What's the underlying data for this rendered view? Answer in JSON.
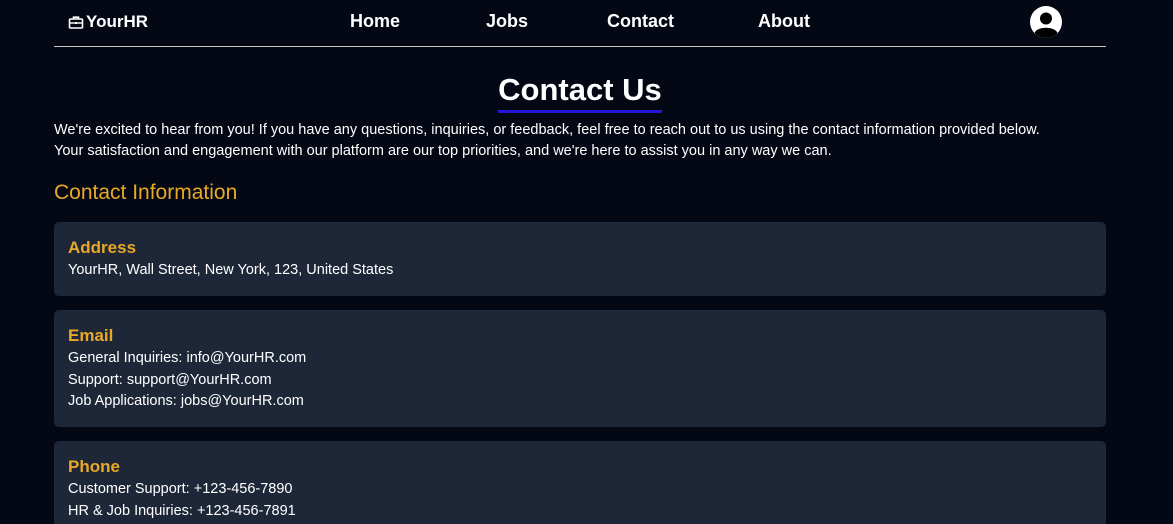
{
  "nav": {
    "brand": "YourHR",
    "links": [
      "Home",
      "Jobs",
      "Contact",
      "About"
    ]
  },
  "page": {
    "title": "Contact Us",
    "intro_line1": "We're excited to hear from you! If you have any questions, inquiries, or feedback, feel free to reach out to us using the contact information provided below.",
    "intro_line2": "Your satisfaction and engagement with our platform are our top priorities, and we're here to assist you in any way we can.",
    "section_title": "Contact Information"
  },
  "cards": {
    "address": {
      "title": "Address",
      "lines": [
        "YourHR, Wall Street, New York, 123, United States"
      ]
    },
    "email": {
      "title": "Email",
      "lines": [
        "General Inquiries: info@YourHR.com",
        "Support: support@YourHR.com",
        "Job Applications: jobs@YourHR.com"
      ]
    },
    "phone": {
      "title": "Phone",
      "lines": [
        "Customer Support: +123-456-7890",
        "HR & Job Inquiries: +123-456-7891"
      ]
    }
  },
  "colors": {
    "background": "#040814",
    "card": "#1e2738",
    "accent": "#e9a825",
    "title_underline": "#2316d8"
  },
  "icons": {
    "brand": "briefcase-icon",
    "avatar": "user-avatar-icon"
  }
}
